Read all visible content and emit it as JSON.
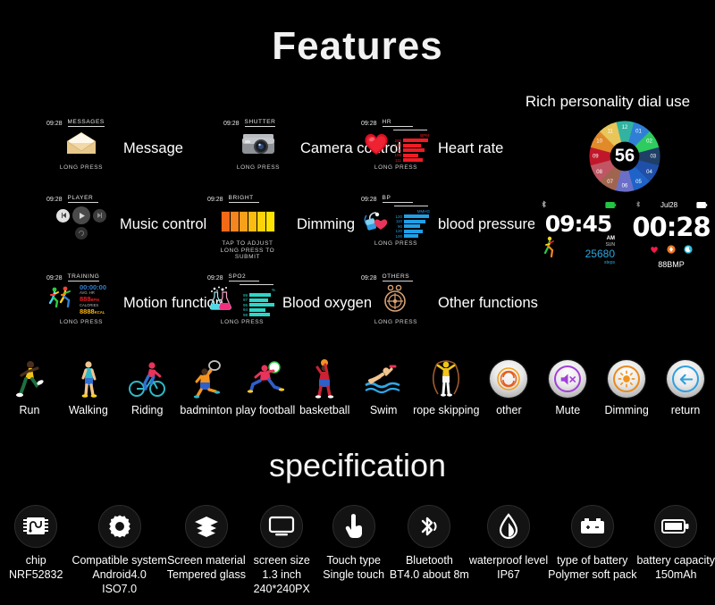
{
  "headings": {
    "features": "Features",
    "specification": "specification",
    "dial_use": "Rich personality dial use"
  },
  "features": [
    {
      "id": "message",
      "time": "09:28",
      "mode": "MESSAGES",
      "label": "Message",
      "hint": "LONG PRESS",
      "icon": "envelope-icon"
    },
    {
      "id": "camera",
      "time": "09:28",
      "mode": "SHUTTER",
      "label": "Camera control",
      "hint": "LONG PRESS",
      "icon": "camera-icon"
    },
    {
      "id": "heart-rate",
      "time": "09:28",
      "mode": "HR",
      "label": "Heart rate",
      "hint": "LONG PRESS",
      "icon": "heart-icon"
    },
    {
      "id": "music",
      "time": "09:28",
      "mode": "PLAYER",
      "label": "Music control",
      "hint": "",
      "icon": "music-player-icon"
    },
    {
      "id": "dimming",
      "time": "09:28",
      "mode": "BRIGHT",
      "label": "Dimming",
      "hint": "TAP TO ADJUST\nLONG PRESS TO SUBMIT",
      "icon": "brightness-bar-icon"
    },
    {
      "id": "blood-pressure",
      "time": "09:28",
      "mode": "BP",
      "label": "blood pressure",
      "hint": "LONG PRESS",
      "icon": "blood-pressure-icon"
    },
    {
      "id": "motion",
      "time": "09:28",
      "mode": "TRAINING",
      "label": "Motion function",
      "hint": "LONG PRESS",
      "icon": "runners-icon"
    },
    {
      "id": "blood-oxygen",
      "time": "09:28",
      "mode": "SPO2",
      "label": "Blood oxygen",
      "hint": "LONG PRESS",
      "icon": "flask-icon"
    },
    {
      "id": "others",
      "time": "09:28",
      "mode": "OTHERS",
      "label": "Other functions",
      "hint": "LONG PRESS",
      "icon": "compass-icon"
    }
  ],
  "dimming_hint_line1": "TAP TO ADJUST",
  "dimming_hint_line2": "LONG PRESS TO SUBMIT",
  "charts": {
    "heart_rate": {
      "unit": "BPM",
      "color": "#ee1c25",
      "values": [
        "200",
        "180",
        "150",
        "100",
        "111"
      ],
      "lengths": [
        34,
        26,
        30,
        22,
        28
      ]
    },
    "blood_pressure": {
      "unit": "MMHG",
      "color": "#1f9fe8",
      "values": [
        "120",
        "110",
        "90",
        "120",
        "100"
      ],
      "lengths": [
        34,
        30,
        22,
        26,
        20
      ]
    },
    "blood_oxygen": {
      "unit": "%",
      "color": "#2fd6c7",
      "values": [
        "99",
        "97",
        "95",
        "94",
        "98"
      ],
      "lengths": [
        30,
        26,
        34,
        22,
        28
      ]
    }
  },
  "motion_panel": {
    "timer": "00:00:00",
    "avg_hr_label": "AVG. HR",
    "avg_hr_value": "888",
    "avg_hr_unit": "BPM",
    "calories_label": "CALORIES",
    "calories_value": "8888",
    "calories_unit": "KCAL"
  },
  "watch_faces": {
    "dial": {
      "center": "56",
      "segments": [
        {
          "label": "12",
          "color": "#31b3a0"
        },
        {
          "label": "01",
          "color": "#2f7fd6"
        },
        {
          "label": "02",
          "color": "#2ecc5e"
        },
        {
          "label": "03",
          "color": "#1f3f66"
        },
        {
          "label": "04",
          "color": "#1f4fa8"
        },
        {
          "label": "05",
          "color": "#1f63c8"
        },
        {
          "label": "06",
          "color": "#6b6fc8"
        },
        {
          "label": "07",
          "color": "#a0654f"
        },
        {
          "label": "08",
          "color": "#c05563"
        },
        {
          "label": "09",
          "color": "#c0182a"
        },
        {
          "label": "10",
          "color": "#e08a2a"
        },
        {
          "label": "11",
          "color": "#e8c659"
        }
      ]
    },
    "steps_face": {
      "time": "09:45",
      "ampm": "AM",
      "day": "SUN",
      "steps": "25680",
      "steps_unit": "steps",
      "battery_icon": "battery-icon",
      "bluetooth_icon": "bluetooth-icon"
    },
    "bpm_face": {
      "time": "00:28",
      "date": "Jul28",
      "bpm": "88BMP",
      "battery_icon": "battery-icon",
      "bluetooth_icon": "bluetooth-icon"
    }
  },
  "sports": [
    {
      "name": "Run",
      "icon": "runner-icon"
    },
    {
      "name": "Walking",
      "icon": "walking-icon"
    },
    {
      "name": "Riding",
      "icon": "cycling-icon"
    },
    {
      "name": "badminton",
      "icon": "badminton-icon"
    },
    {
      "name": "play football",
      "icon": "football-icon"
    },
    {
      "name": "basketball",
      "icon": "basketball-icon"
    },
    {
      "name": "Swim",
      "icon": "swimming-icon"
    },
    {
      "name": "rope skipping",
      "icon": "jump-rope-icon"
    },
    {
      "name": "other",
      "icon": "other-circle-icon"
    },
    {
      "name": "Mute",
      "icon": "mute-icon"
    },
    {
      "name": "Dimming",
      "icon": "sun-brightness-icon"
    },
    {
      "name": "return",
      "icon": "back-arrow-icon"
    }
  ],
  "specs": [
    {
      "icon": "chip-icon",
      "line1": "chip",
      "line2": "NRF52832",
      "line3": ""
    },
    {
      "icon": "gear-icon",
      "line1": "Compatible system",
      "line2": "Android4.0",
      "line3": "ISO7.0"
    },
    {
      "icon": "layers-icon",
      "line1": "Screen material",
      "line2": "Tempered glass",
      "line3": ""
    },
    {
      "icon": "monitor-icon",
      "line1": "screen size",
      "line2": "1.3 inch",
      "line3": "240*240PX"
    },
    {
      "icon": "touch-icon",
      "line1": "Touch type",
      "line2": "Single touch",
      "line3": ""
    },
    {
      "icon": "bluetooth-icon",
      "line1": "Bluetooth",
      "line2": "BT4.0  about 8m",
      "line3": ""
    },
    {
      "icon": "water-drop-icon",
      "line1": "waterproof level",
      "line2": "IP67",
      "line3": ""
    },
    {
      "icon": "car-battery-icon",
      "line1": "type of battery",
      "line2": "Polymer soft pack",
      "line3": ""
    },
    {
      "icon": "battery-icon",
      "line1": "battery capacity",
      "line2": "150mAh",
      "line3": ""
    }
  ]
}
